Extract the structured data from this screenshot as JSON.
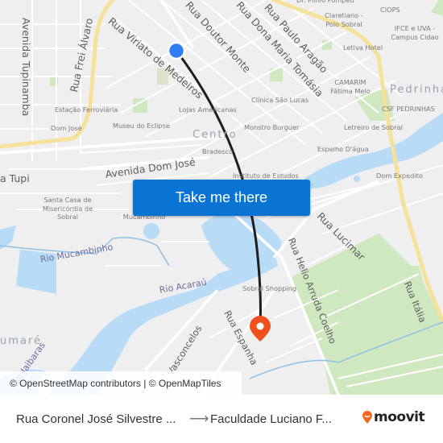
{
  "map": {
    "streets": [
      {
        "name": "Avenida Tupinamba",
        "rotate": 90
      },
      {
        "name": "Rua Frei Álvaro",
        "rotate": -78
      },
      {
        "name": "Rua Viriato de Medeiros",
        "rotate": 40
      },
      {
        "name": "Rua Doutor Monte",
        "rotate": 48
      },
      {
        "name": "Rua Dona Maria Tomásia",
        "rotate": 48
      },
      {
        "name": "Rua Paulo Aragão",
        "rotate": 48
      },
      {
        "name": "Avenida Dom José",
        "rotate": -8
      },
      {
        "name": "a Tupi",
        "rotate": 0
      },
      {
        "name": "Rua Lucimar",
        "rotate": 45
      },
      {
        "name": "Rua Helio Arruda Coelho",
        "rotate": 68
      },
      {
        "name": "Rua Itália",
        "rotate": 68
      },
      {
        "name": "Rua Espanha",
        "rotate": 62
      },
      {
        "name": "Vasconcelos",
        "rotate": -58
      }
    ],
    "pois": [
      "Dr. Plínio Pompeu",
      "Claretiano - Polo Sobral",
      "CIOPS",
      "IFCE e UVA - Campus Cidao",
      "Letiva Hotel",
      "CAMARIM Fátima Melo",
      "CSF PEDRINHAS",
      "Letreiro de Sobral",
      "Estação Ferroviária",
      "Lojas Americanas",
      "Clínica São Lucas",
      "Dom José",
      "Museu do Eclipse",
      "Monstro Burguer",
      "Bradesco",
      "Espelho D'água",
      "Instituto de Estudos",
      "Dom Expedito",
      "Santa Casa de Misericórdia de Sobral",
      "UFC - Mucambinho",
      "Sobral Shopping"
    ],
    "districts": [
      "Centro",
      "Pedrinhas",
      "umaré"
    ],
    "waterways": [
      "Rio Mucambinho",
      "Rio Acaraú",
      "Rio Jaibaras"
    ],
    "origin_marker": {
      "type": "origin",
      "color": "#2f7ef5"
    },
    "destination_marker": {
      "type": "destination",
      "color": "#f0501e"
    },
    "route_color": "#1e1e1e",
    "cta_label": "Take me there",
    "cta_color": "#0a74d4",
    "attribution": "© OpenStreetMap contributors | © OpenMapTiles"
  },
  "footer": {
    "from": "Rua Coronel José Silvestre ...",
    "arrow": "⟶",
    "to": "Faculdade Luciano F...",
    "brand": "moovit",
    "brand_color": "#f26a21"
  }
}
